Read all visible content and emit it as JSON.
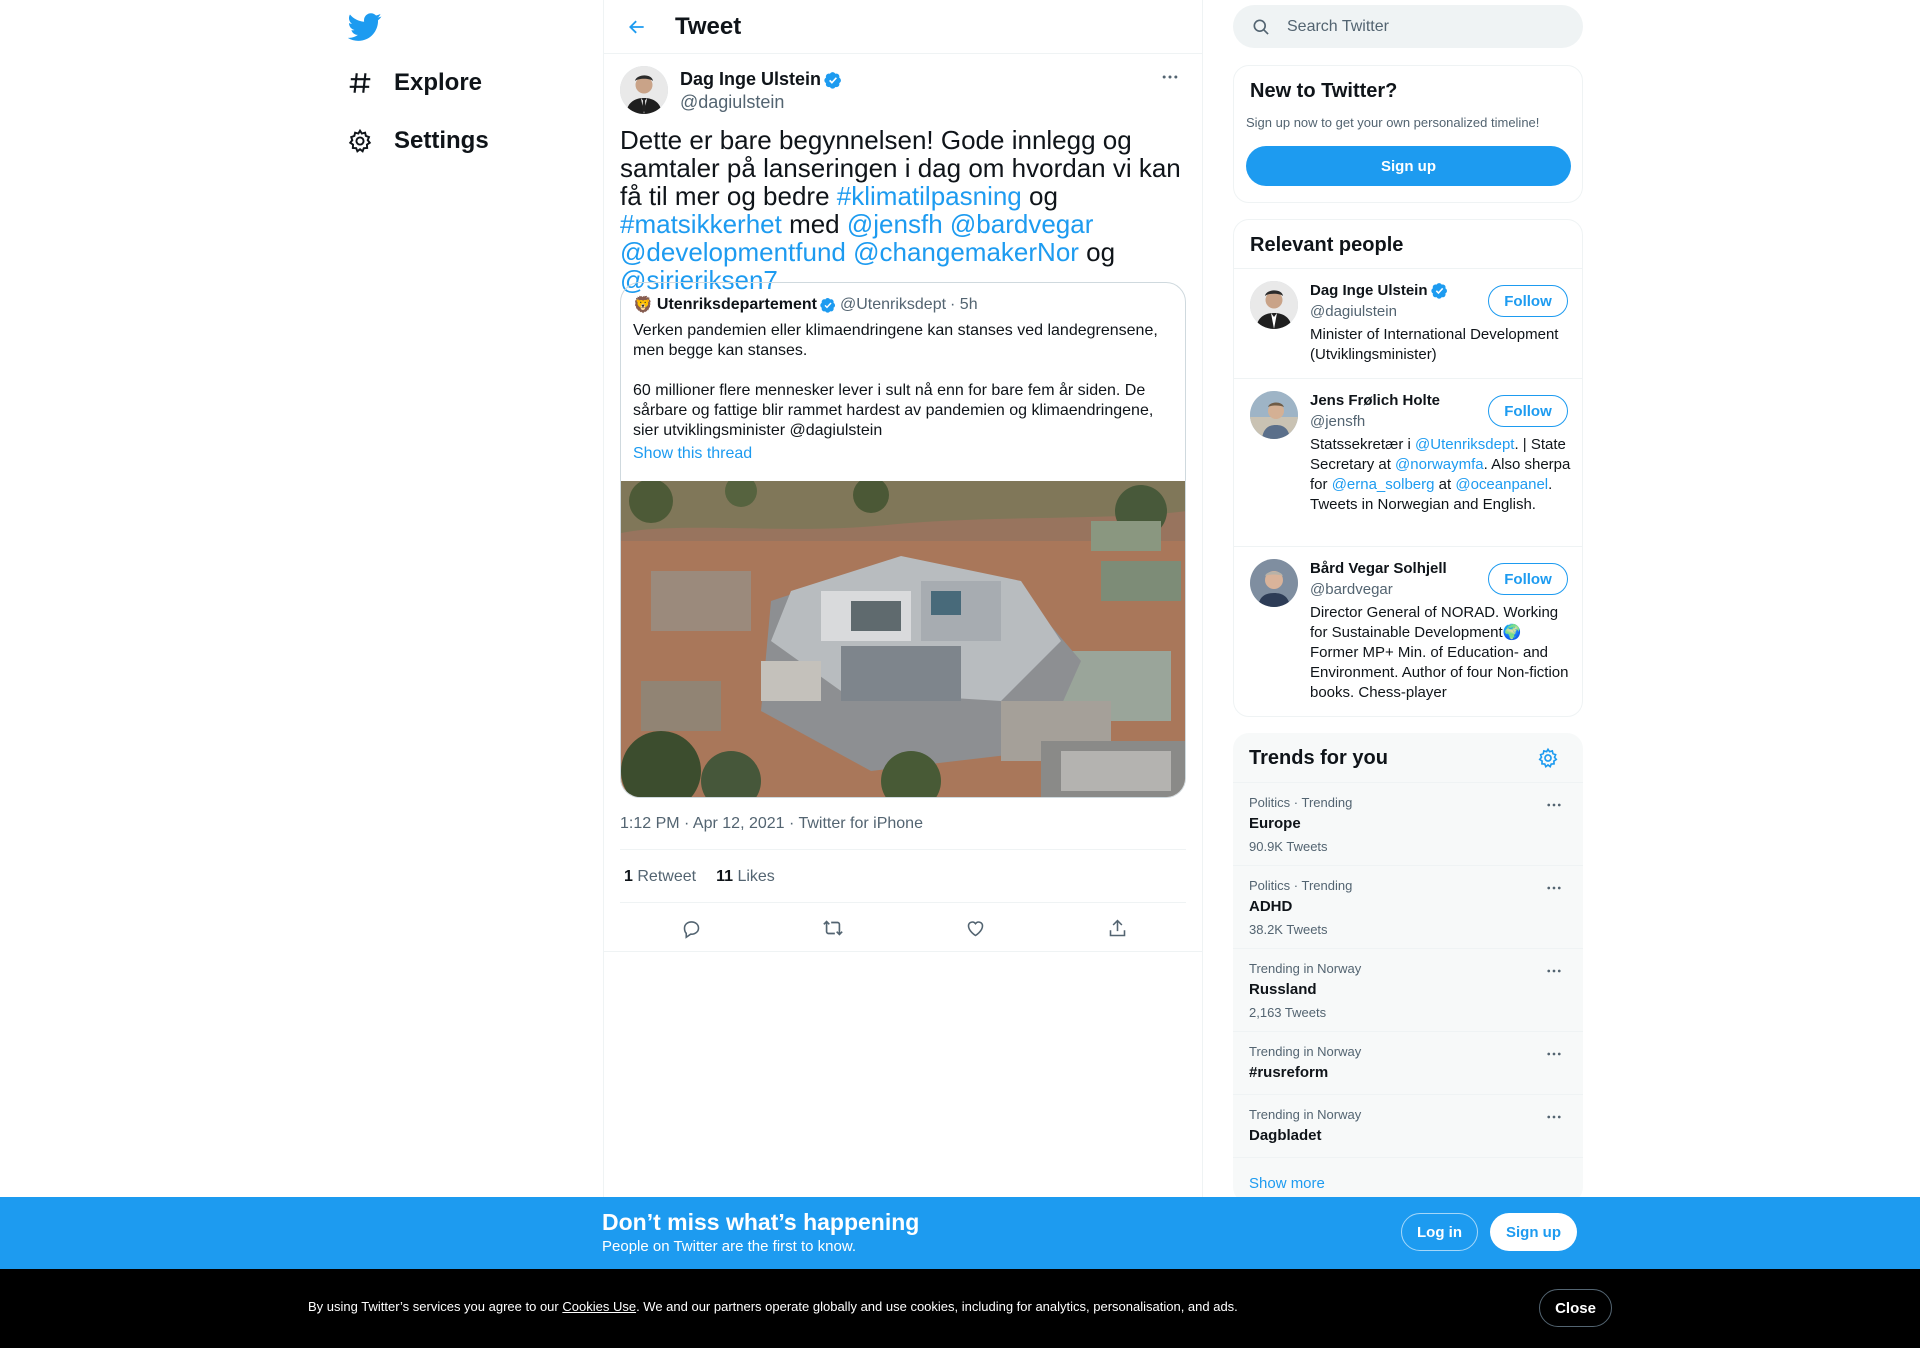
{
  "nav": {
    "logo_icon": "twitter-bird-icon",
    "explore_label": "Explore",
    "settings_label": "Settings"
  },
  "header": {
    "title": "Tweet"
  },
  "tweet": {
    "author_name": "Dag Inge Ulstein",
    "author_handle": "@dagiulstein",
    "text_parts": {
      "p1": "Dette er bare begynnelsen! Gode innlegg og samtaler på lanseringen i dag om hvordan vi kan få til mer og bedre ",
      "tag1": "#klimatilpasning",
      "p2": " og ",
      "tag2": "#matsikkerhet",
      "p3": " med ",
      "m1": "@jensfh",
      "m2": "@bardvegar",
      "m3": "@developmentfund",
      "m4": "@changemakerNor",
      "p4": " og ",
      "m5": "@sirieriksen7"
    },
    "quote": {
      "emoji": "🦁",
      "name": "Utenriksdepartement",
      "handle": "@Utenriksdept",
      "time": "· 5h",
      "text1": "Verken pandemien eller klimaendringene kan stanses ved landegrensene, men begge kan stanses.",
      "text2": "60 millioner flere mennesker lever i sult nå enn for bare fem år siden. De sårbare og fattige blir rammet hardest av pandemien og klimaendringene, sier utviklingsminister @dagiulstein",
      "show_thread": "Show this thread"
    },
    "meta": "1:12 PM · Apr 12, 2021 · Twitter for iPhone",
    "retweets": "1",
    "retweets_label": "Retweet",
    "likes": "11",
    "likes_label": "Likes"
  },
  "search": {
    "placeholder": "Search Twitter"
  },
  "new_to_twitter": {
    "title": "New to Twitter?",
    "subtitle": "Sign up now to get your own personalized timeline!",
    "signup_label": "Sign up"
  },
  "relevant_people": {
    "title": "Relevant people",
    "follow_label": "Follow",
    "people": [
      {
        "name": "Dag Inge Ulstein",
        "handle": "@dagiulstein",
        "verified": true,
        "bio": "Minister of International Development (Utviklingsminister)"
      },
      {
        "name": "Jens Frølich Holte",
        "handle": "@jensfh",
        "verified": false,
        "bio_parts": {
          "a": "Statssekretær i ",
          "b": "@Utenriksdept",
          "c": ". | State Secretary at ",
          "d": "@norwaymfa",
          "e": ". Also sherpa for ",
          "f": "@erna_solberg",
          "g": " at ",
          "h": "@oceanpanel",
          "i": ". Tweets in Norwegian and English."
        }
      },
      {
        "name": "Bård Vegar Solhjell",
        "handle": "@bardvegar",
        "verified": false,
        "bio": "Director General of NORAD. Working for Sustainable Development🌍 Former MP+ Min. of Education- and Environment. Author of four Non-fiction books. Chess-player"
      }
    ]
  },
  "trends": {
    "title": "Trends for you",
    "items": [
      {
        "context": "Politics · Trending",
        "name": "Europe",
        "count": "90.9K Tweets"
      },
      {
        "context": "Politics · Trending",
        "name": "ADHD",
        "count": "38.2K Tweets"
      },
      {
        "context": "Trending in Norway",
        "name": "Russland",
        "count": "2,163 Tweets"
      },
      {
        "context": "Trending in Norway",
        "name": "#rusreform",
        "count": ""
      },
      {
        "context": "Trending in Norway",
        "name": "Dagbladet",
        "count": ""
      }
    ],
    "show_more": "Show more"
  },
  "signup_bar": {
    "title": "Don’t miss what’s happening",
    "subtitle": "People on Twitter are the first to know.",
    "login_label": "Log in",
    "signup_label": "Sign up"
  },
  "cookie_bar": {
    "text_before": "By using Twitter’s services you agree to our ",
    "link": "Cookies Use",
    "text_after": ". We and our partners operate globally and use cookies, including for analytics, personalisation, and ads.",
    "close_label": "Close"
  },
  "colors": {
    "accent": "#1d9bf0",
    "text": "#0f1419",
    "secondary": "#536471",
    "cookie_bg": "#000000"
  }
}
